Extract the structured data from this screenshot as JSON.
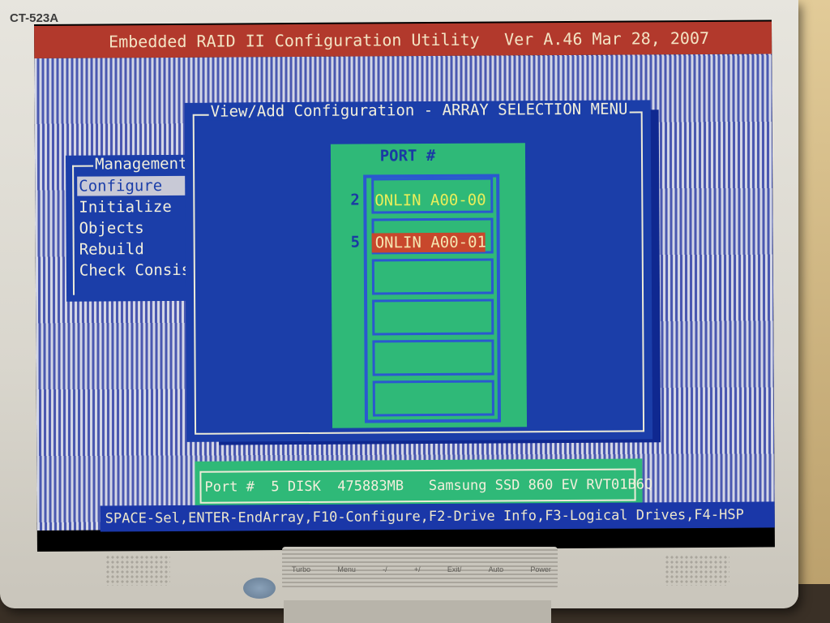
{
  "monitor": {
    "model_label": "CT-523A",
    "controls": [
      "Turbo",
      "Menu",
      "-/",
      "+/",
      "Exit/",
      "Auto",
      "Power"
    ]
  },
  "utility": {
    "title": "Embedded RAID II Configuration Utility",
    "version": "Ver A.46 Mar 28, 2007"
  },
  "management": {
    "title": "Management",
    "items": [
      {
        "label": "Configure",
        "selected": true
      },
      {
        "label": "Initialize"
      },
      {
        "label": "Objects"
      },
      {
        "label": "Rebuild"
      },
      {
        "label": "Check Consis"
      }
    ]
  },
  "config_window": {
    "title": "View/Add Configuration - ARRAY SELECTION MENU",
    "port_header": "PORT #",
    "ports": [
      {
        "number": "2",
        "status": "ONLIN A00-00",
        "selected": false
      },
      {
        "number": "5",
        "status": "ONLIN A00-01",
        "selected": true
      }
    ]
  },
  "info_bar": {
    "text": "Port #  5 DISK  475883MB   Samsung SSD 860 EV RVT01B6Q"
  },
  "help_bar": {
    "text": "SPACE-Sel,ENTER-EndArray,F10-Configure,F2-Drive Info,F3-Logical Drives,F4-HSP"
  },
  "colors": {
    "title_red": "#b2392c",
    "window_blue": "#1b3ea9",
    "panel_green": "#2fb978",
    "online_yellow": "#e8ee5a",
    "selected_red": "#c8472c"
  }
}
